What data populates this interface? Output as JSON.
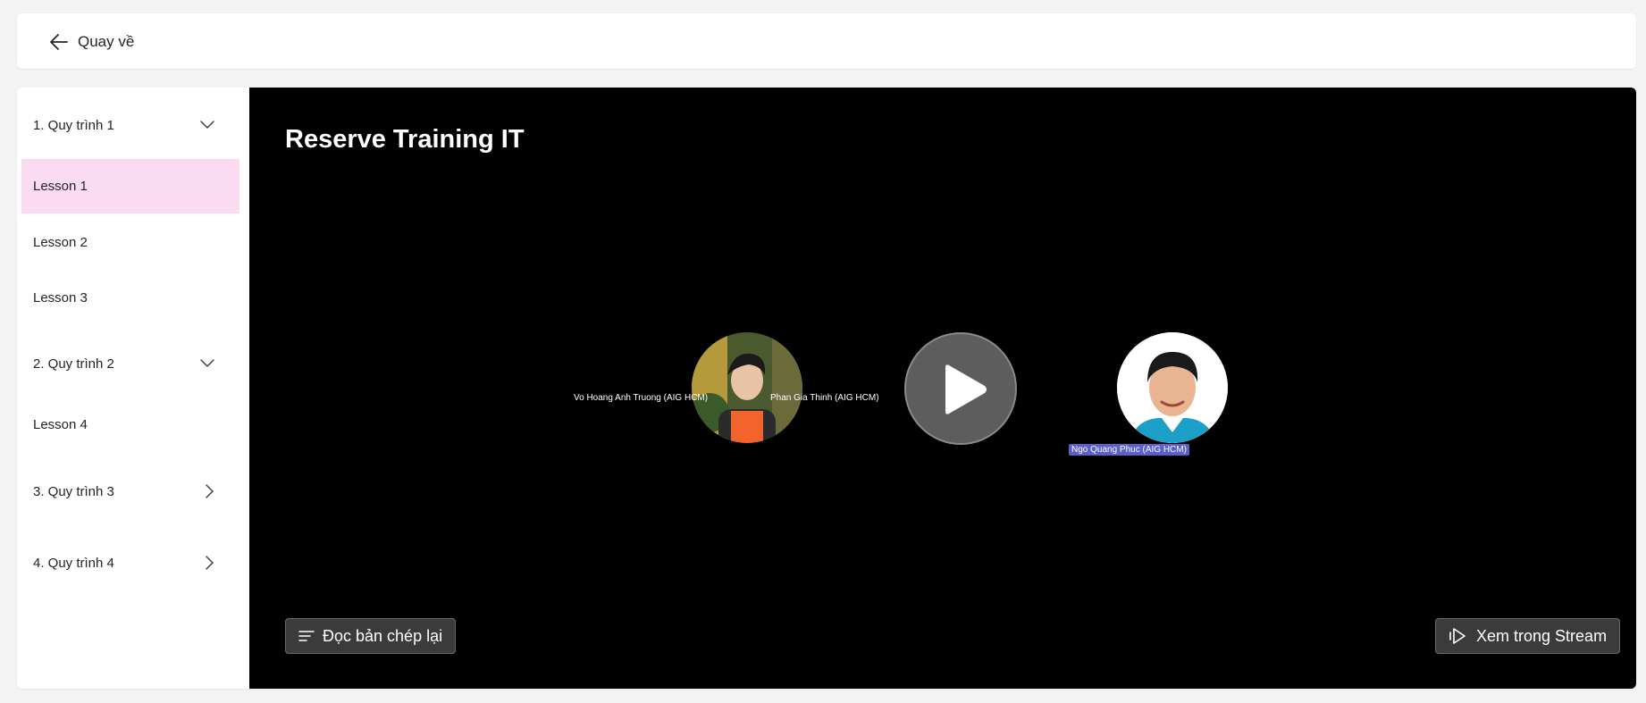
{
  "header": {
    "back_label": "Quay về"
  },
  "sidebar": {
    "items": [
      {
        "label": "1. Quy trình 1"
      },
      {
        "label": "Lesson 1"
      },
      {
        "label": "Lesson 2"
      },
      {
        "label": "Lesson 3"
      },
      {
        "label": "2. Quy trình 2"
      },
      {
        "label": "Lesson 4"
      },
      {
        "label": "3. Quy trình 3"
      },
      {
        "label": "4. Quy trình 4"
      }
    ],
    "active_color": "#fbdbf2"
  },
  "video": {
    "title": "Reserve Training IT",
    "participants": [
      {
        "name": "Vo Hoang Anh Truong (AIG HCM)"
      },
      {
        "name": "Phan Gia Thinh (AIG HCM)"
      },
      {
        "name": "Ngo Quang Phuc (AIG HCM)"
      }
    ],
    "transcript_button": "Đọc bản chép lại",
    "stream_button": "Xem trong Stream",
    "highlight_color": "#5b5fc7"
  },
  "icons": {
    "back": "arrow-left-icon",
    "expand": "chevron-down-icon",
    "collapsed": "chevron-right-icon",
    "play": "play-icon",
    "transcript": "transcript-lines-icon",
    "stream": "stream-play-icon"
  }
}
